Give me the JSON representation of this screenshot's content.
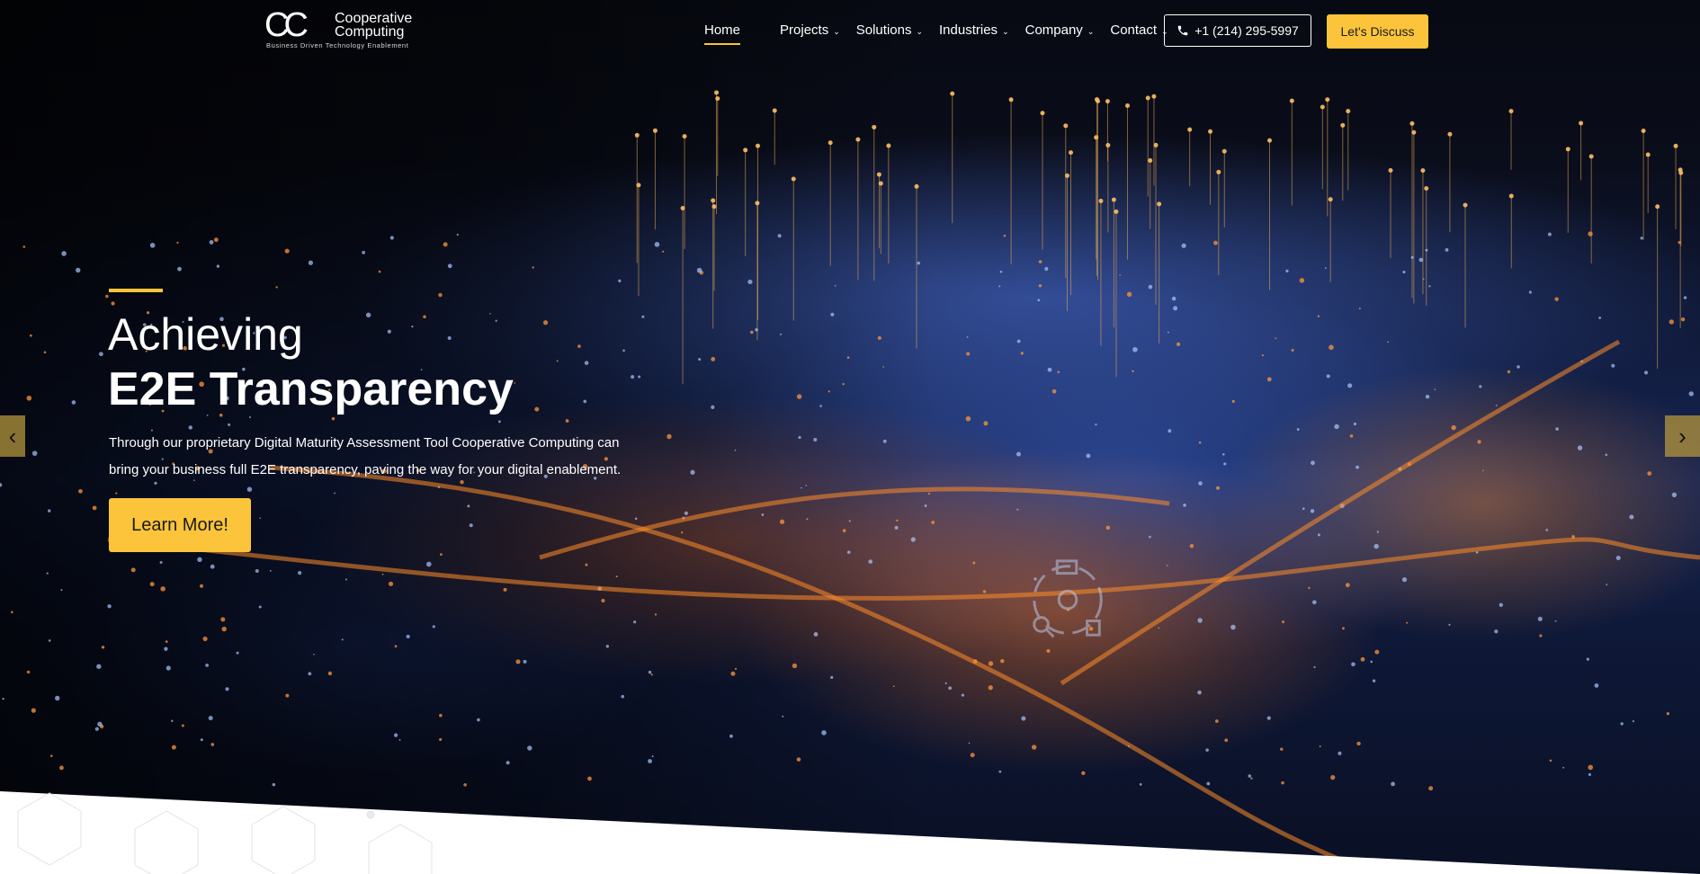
{
  "header": {
    "logo_mark": "CC",
    "logo_name_line1": "Cooperative",
    "logo_name_line2": "Computing",
    "logo_tagline": "Business Driven Technology Enablement",
    "nav": [
      {
        "label": "Home",
        "active": true,
        "has_dropdown": false
      },
      {
        "label": "Projects",
        "has_dropdown": true
      },
      {
        "label": "Solutions",
        "has_dropdown": true
      },
      {
        "label": "Industries",
        "has_dropdown": true
      },
      {
        "label": "Company",
        "has_dropdown": true
      },
      {
        "label": "Contact",
        "has_dropdown": true
      }
    ],
    "phone": "+1 (214) 295-5997",
    "cta": "Let's Discuss"
  },
  "hero": {
    "title_line1": "Achieving",
    "title_line2": "E2E Transparency",
    "description": "Through our proprietary Digital Maturity Assessment Tool Cooperative Computing can bring your business full E2E transparency, paving the way for your digital enablement.",
    "button": "Learn More!",
    "prev_icon": "chevron-left-icon",
    "next_icon": "chevron-right-icon"
  },
  "colors": {
    "accent": "#fbc43a",
    "text": "#ffffff",
    "background": "#0a1024"
  }
}
